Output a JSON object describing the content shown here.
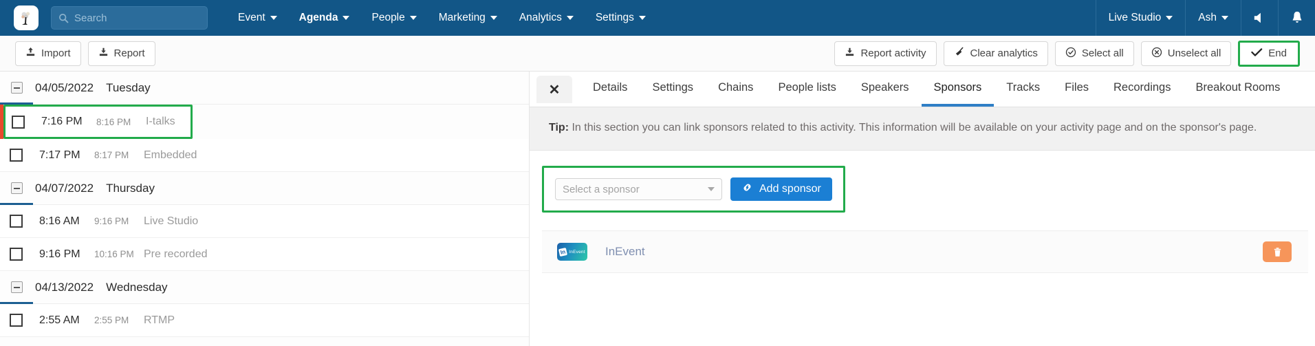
{
  "navbar": {
    "logo_icon": "app-logo-icon",
    "search": {
      "placeholder": "Search",
      "value": ""
    },
    "menu": [
      {
        "label": "Event",
        "active": false
      },
      {
        "label": "Agenda",
        "active": true
      },
      {
        "label": "People",
        "active": false
      },
      {
        "label": "Marketing",
        "active": false
      },
      {
        "label": "Analytics",
        "active": false
      },
      {
        "label": "Settings",
        "active": false
      }
    ],
    "right": [
      {
        "label": "Live Studio"
      },
      {
        "label": "Ash"
      }
    ],
    "icons": [
      "megaphone-icon",
      "bell-icon"
    ],
    "background_color": "#125687"
  },
  "toolbar": {
    "left": [
      {
        "label": "Import",
        "icon": "upload-icon"
      },
      {
        "label": "Report",
        "icon": "download-icon"
      }
    ],
    "right": [
      {
        "label": "Report activity",
        "icon": "download-icon",
        "highlighted": false
      },
      {
        "label": "Clear analytics",
        "icon": "broom-icon",
        "highlighted": false
      },
      {
        "label": "Select all",
        "icon": "check-circle-icon",
        "highlighted": false
      },
      {
        "label": "Unselect all",
        "icon": "x-circle-icon",
        "highlighted": false
      },
      {
        "label": "End",
        "icon": "check-icon",
        "highlighted": true
      }
    ],
    "highlight_color": "#22ab4b"
  },
  "agenda": {
    "groups": [
      {
        "date": "04/05/2022",
        "weekday": "Tuesday",
        "activities": [
          {
            "start": "7:16 PM",
            "end": "8:16 PM",
            "name": "I-talks",
            "selected": true,
            "checked": false
          },
          {
            "start": "7:17 PM",
            "end": "8:17 PM",
            "name": "Embedded",
            "selected": false,
            "checked": false
          }
        ]
      },
      {
        "date": "04/07/2022",
        "weekday": "Thursday",
        "activities": [
          {
            "start": "8:16 AM",
            "end": "9:16 PM",
            "name": "Live Studio",
            "selected": false,
            "checked": false
          },
          {
            "start": "9:16 PM",
            "end": "10:16 PM",
            "name": "Pre recorded",
            "selected": false,
            "checked": false
          }
        ]
      },
      {
        "date": "04/13/2022",
        "weekday": "Wednesday",
        "activities": [
          {
            "start": "2:55 AM",
            "end": "2:55 PM",
            "name": "RTMP",
            "selected": false,
            "checked": false
          }
        ]
      }
    ]
  },
  "panel": {
    "close_label": "✕",
    "tabs": [
      {
        "label": "Details",
        "active": false
      },
      {
        "label": "Settings",
        "active": false
      },
      {
        "label": "Chains",
        "active": false
      },
      {
        "label": "People lists",
        "active": false
      },
      {
        "label": "Speakers",
        "active": false
      },
      {
        "label": "Sponsors",
        "active": true
      },
      {
        "label": "Tracks",
        "active": false
      },
      {
        "label": "Files",
        "active": false
      },
      {
        "label": "Recordings",
        "active": false
      },
      {
        "label": "Breakout Rooms",
        "active": false
      }
    ],
    "active_tab_color": "#2f7fc6",
    "tip": {
      "label": "Tip:",
      "text": " In this section you can link sponsors related to this activity. This information will be available on your activity page and on the sponsor's page."
    },
    "sponsor_picker": {
      "select_placeholder": "Select a sponsor",
      "add_button_label": "Add sponsor",
      "add_button_icon": "link-icon",
      "add_button_color": "#1b7fd4",
      "highlighted": true
    },
    "sponsors": [
      {
        "name": "InEvent",
        "logo_text": "InEvent",
        "delete_icon": "trash-icon",
        "delete_color": "#f6955a"
      }
    ]
  }
}
